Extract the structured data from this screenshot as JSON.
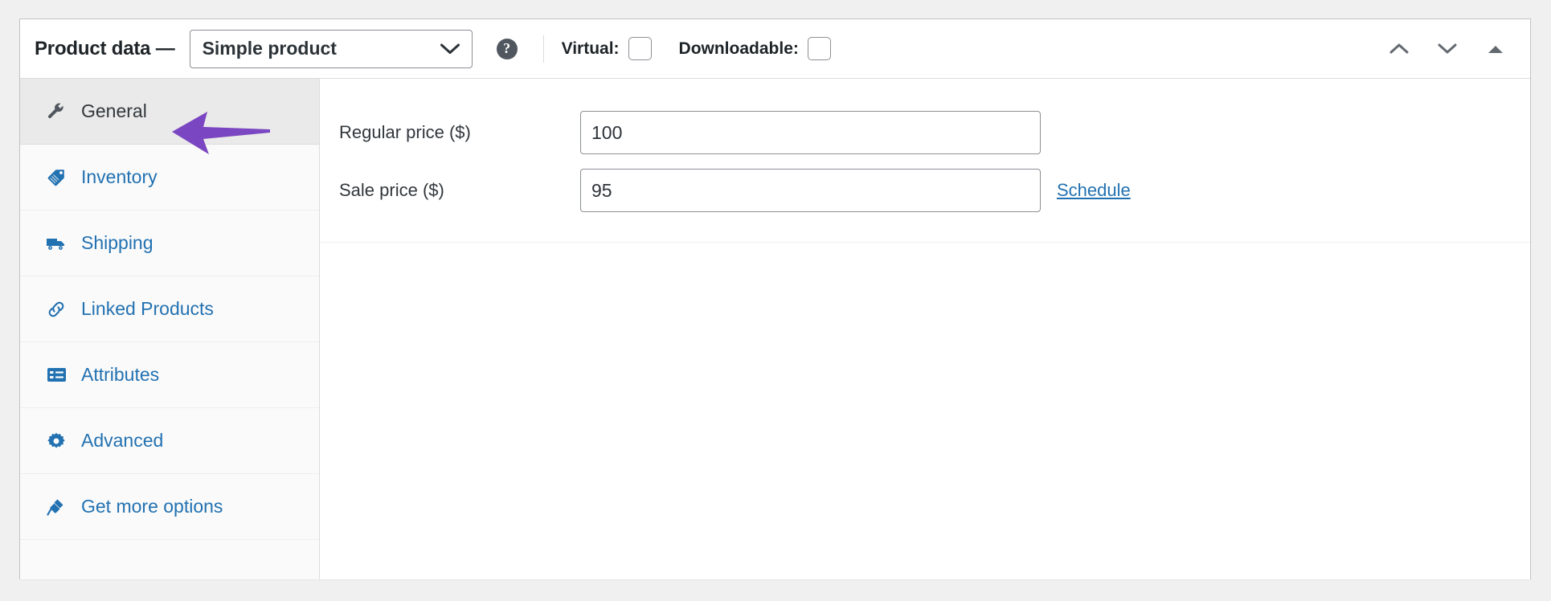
{
  "header": {
    "title": "Product data —",
    "product_type": {
      "value": "Simple product",
      "caret_icon": "chevron-down-icon"
    },
    "help_icon": "help-question-icon",
    "help_glyph": "?",
    "checkboxes": [
      {
        "label": "Virtual:",
        "checked": false,
        "name": "virtual"
      },
      {
        "label": "Downloadable:",
        "checked": false,
        "name": "downloadable"
      }
    ],
    "actions": [
      {
        "name": "move-up-button",
        "icon": "chevron-up-icon"
      },
      {
        "name": "move-down-button",
        "icon": "chevron-down-icon"
      },
      {
        "name": "toggle-panel-button",
        "icon": "triangle-up-icon"
      }
    ]
  },
  "tabs": [
    {
      "label": "General",
      "icon": "wrench-icon",
      "active": true
    },
    {
      "label": "Inventory",
      "icon": "tag-icon",
      "active": false
    },
    {
      "label": "Shipping",
      "icon": "truck-icon",
      "active": false
    },
    {
      "label": "Linked Products",
      "icon": "link-icon",
      "active": false
    },
    {
      "label": "Attributes",
      "icon": "list-card-icon",
      "active": false
    },
    {
      "label": "Advanced",
      "icon": "gear-icon",
      "active": false
    },
    {
      "label": "Get more options",
      "icon": "plug-icon",
      "active": false
    }
  ],
  "general_panel": {
    "fields": [
      {
        "label": "Regular price ($)",
        "value": "100",
        "name": "regular-price"
      },
      {
        "label": "Sale price ($)",
        "value": "95",
        "name": "sale-price",
        "link": "Schedule"
      }
    ]
  },
  "annotation": {
    "arrow_color": "#7b46c1",
    "points_at": "General"
  },
  "colors": {
    "link": "#2271b1",
    "text": "#32373c",
    "panel_border": "#c3c4c7",
    "active_tab_bg": "#eaeaea",
    "page_bg": "#f0f0f1"
  }
}
